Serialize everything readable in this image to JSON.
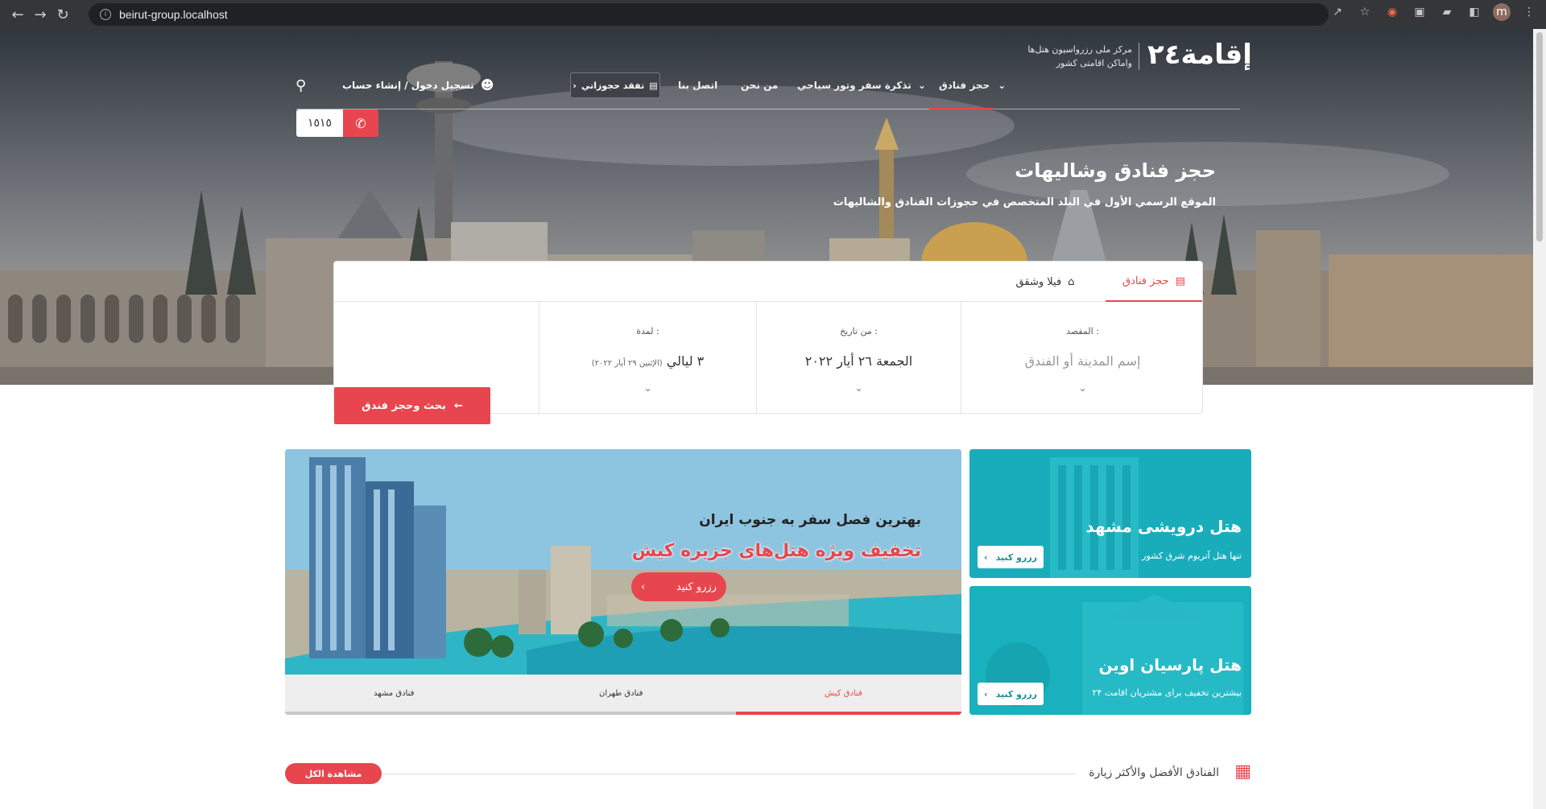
{
  "browser": {
    "url": "beirut-group.localhost",
    "profile_initial": "m"
  },
  "header": {
    "logo": "إقامة٢٤",
    "logo_sub_line1": "مرکز ملی رزرواسیون هتل‌ها",
    "logo_sub_line2": "واماکن اقامتی کشور",
    "menu": [
      {
        "label": "حجز فنادق",
        "active": true
      },
      {
        "label": "تذكرة سفر وتور سياحي"
      },
      {
        "label": "من نحن"
      },
      {
        "label": "اتصل بنا"
      }
    ],
    "track_label": "تفقد حجوزاتي",
    "login_label": "تسجيل دخول / إنشاء حساب",
    "phone": "١٥١٥"
  },
  "hero": {
    "title": "حجز فنادق وشاليهات",
    "subtitle": "الموقع الرسمي الأول في البلد المتخصص في حجوزات الفنادق والشاليهات"
  },
  "search": {
    "tab_hotels": "حجز فنادق",
    "tab_villas": "فيلا وشقق",
    "destination_label": "المقصد :",
    "destination_placeholder": "إسم المدينة أو الفندق",
    "from_label": "من تاريخ :",
    "from_value": "الجمعة ٢٦ أيار ٢٠٢٢",
    "duration_label": "لمدة :",
    "duration_value": "٣ ليالي",
    "duration_note": "(الإثنين ٢٩ أيار ٢٠٢٢)",
    "button_label": "بحث وحجز فندق"
  },
  "main_banner": {
    "headline1": "بهترین فصل سفر به جنوب ایران",
    "headline2": "تخفیف ویژه هتل‌های جزیره کیش",
    "button_label": "رزرو کنید",
    "tabs": [
      "فنادق كيش",
      "فنادق طهران",
      "فنادق مشهد"
    ]
  },
  "side_banners": [
    {
      "title": "هتل درویشی مشهد",
      "subtitle": "تنها هتل آتریوم شرق کشور",
      "button_label": "رزرو کنید"
    },
    {
      "title": "هتل پارسیان اوین",
      "subtitle": "بیشترین تخفیف برای مشتریان اقامت ۲۴",
      "button_label": "رزرو کنید"
    }
  ],
  "section": {
    "title": "الفنادق الأفضل والأكثر زيارة",
    "view_all": "مشاهدة الكل"
  },
  "colors": {
    "accent": "#e8464e",
    "teal": "#1ab1bf"
  }
}
